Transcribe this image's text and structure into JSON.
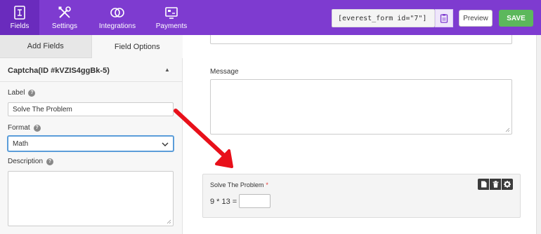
{
  "nav": {
    "fields": "Fields",
    "settings": "Settings",
    "integrations": "Integrations",
    "payments": "Payments"
  },
  "header": {
    "shortcode": "[everest_form id=\"7\"]",
    "preview_label": "Preview",
    "save_label": "SAVE"
  },
  "left_panel": {
    "tab_add_fields": "Add Fields",
    "tab_field_options": "Field Options",
    "section_title": "Captcha(ID #kVZIS4ggBk-5)",
    "label_heading": "Label",
    "label_value": "Solve The Problem",
    "format_heading": "Format",
    "format_value": "Math",
    "description_heading": "Description"
  },
  "form": {
    "message_label": "Message",
    "captcha_label": "Solve The Problem",
    "required_mark": "*",
    "captcha_question": "9 * 13 ="
  },
  "colors": {
    "brand": "#7e3bd0",
    "save": "#5cb85c",
    "arrow": "#e8101a"
  }
}
